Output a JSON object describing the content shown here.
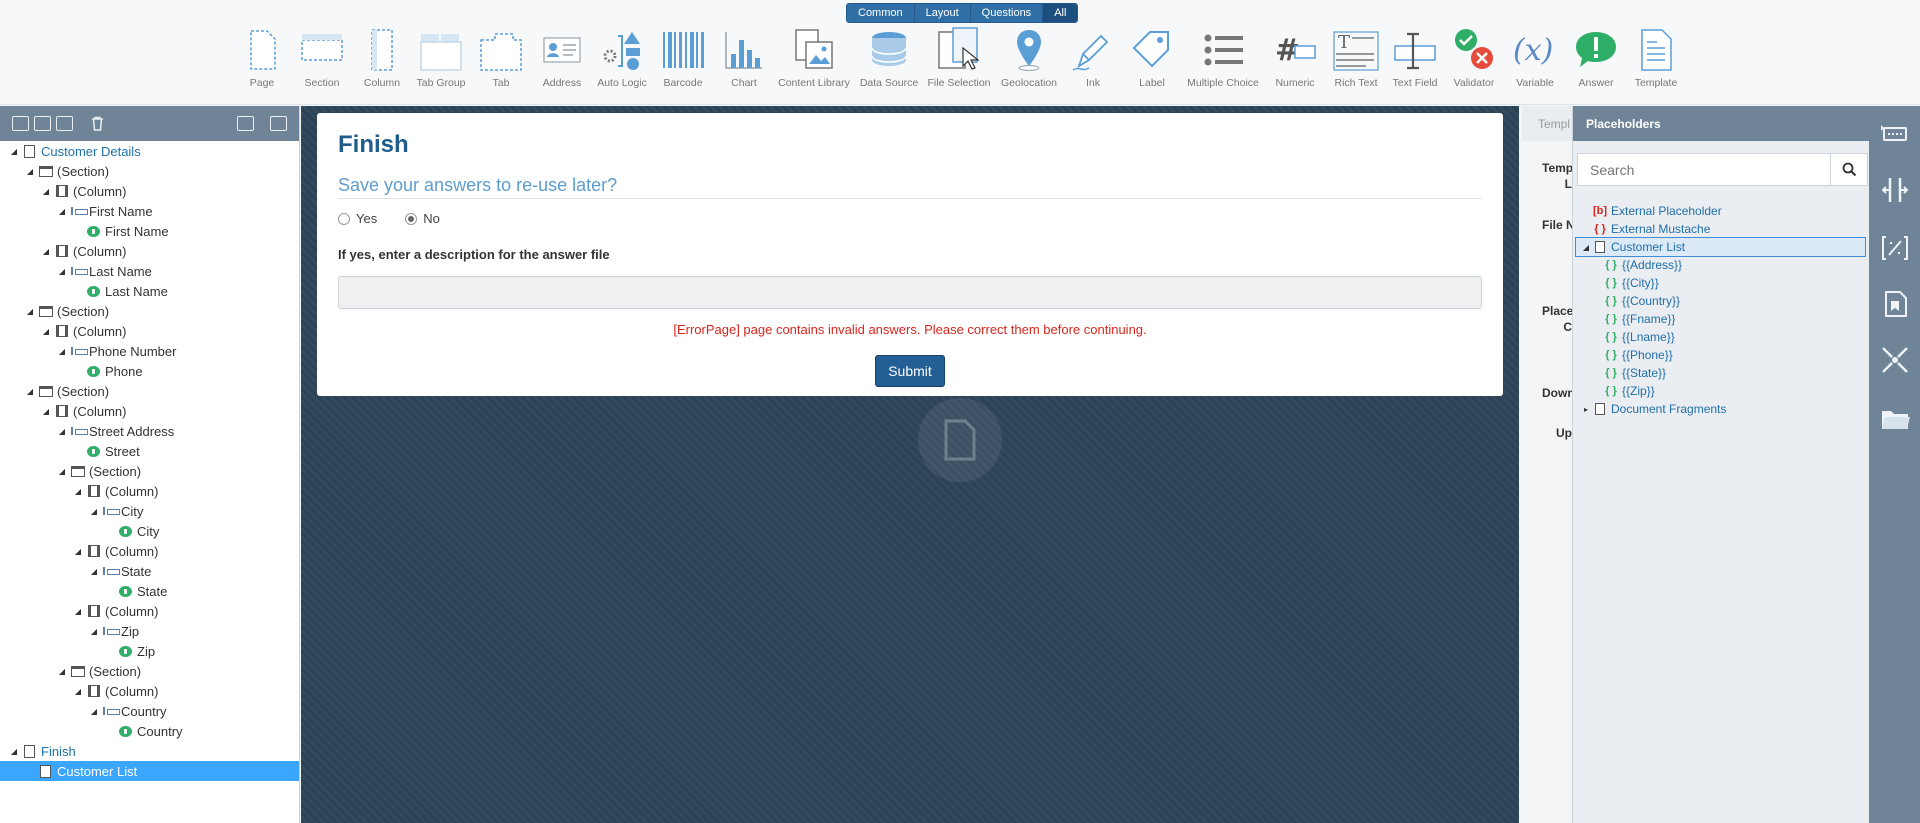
{
  "toolbar": {
    "tabs": [
      {
        "label": "Common",
        "active": false
      },
      {
        "label": "Layout",
        "active": false
      },
      {
        "label": "Questions",
        "active": false
      },
      {
        "label": "All",
        "active": true
      }
    ],
    "tools": [
      {
        "label": "Page",
        "icon": "page-icon"
      },
      {
        "label": "Section",
        "icon": "section-icon"
      },
      {
        "label": "Column",
        "icon": "column-icon"
      },
      {
        "label": "Tab Group",
        "icon": "tab-group-icon"
      },
      {
        "label": "Tab",
        "icon": "tab-icon"
      },
      {
        "label": "Address",
        "icon": "address-icon"
      },
      {
        "label": "Auto Logic",
        "icon": "auto-logic-icon"
      },
      {
        "label": "Barcode",
        "icon": "barcode-icon"
      },
      {
        "label": "Chart",
        "icon": "chart-icon"
      },
      {
        "label": "Content Library",
        "icon": "content-library-icon"
      },
      {
        "label": "Data Source",
        "icon": "data-source-icon"
      },
      {
        "label": "File Selection",
        "icon": "file-selection-icon"
      },
      {
        "label": "Geolocation",
        "icon": "geolocation-icon"
      },
      {
        "label": "Ink",
        "icon": "ink-icon"
      },
      {
        "label": "Label",
        "icon": "label-icon"
      },
      {
        "label": "Multiple Choice",
        "icon": "multiple-choice-icon"
      },
      {
        "label": "Numeric",
        "icon": "numeric-icon"
      },
      {
        "label": "Rich Text",
        "icon": "rich-text-icon"
      },
      {
        "label": "Text Field",
        "icon": "text-field-icon"
      },
      {
        "label": "Validator",
        "icon": "validator-icon"
      },
      {
        "label": "Variable",
        "icon": "variable-icon"
      },
      {
        "label": "Answer",
        "icon": "answer-icon"
      },
      {
        "label": "Template",
        "icon": "template-icon"
      }
    ]
  },
  "tree": [
    {
      "label": "Customer Details",
      "type": "page",
      "depth": 0
    },
    {
      "label": "(Section)",
      "type": "section",
      "depth": 1
    },
    {
      "label": "(Column)",
      "type": "column",
      "depth": 2
    },
    {
      "label": "First Name",
      "type": "field",
      "depth": 3
    },
    {
      "label": "First Name",
      "type": "answer",
      "depth": 4
    },
    {
      "label": "(Column)",
      "type": "column",
      "depth": 2
    },
    {
      "label": "Last Name",
      "type": "field",
      "depth": 3
    },
    {
      "label": "Last Name",
      "type": "answer",
      "depth": 4
    },
    {
      "label": "(Section)",
      "type": "section",
      "depth": 1
    },
    {
      "label": "(Column)",
      "type": "column",
      "depth": 2
    },
    {
      "label": "Phone Number",
      "type": "field",
      "depth": 3
    },
    {
      "label": "Phone",
      "type": "answer",
      "depth": 4
    },
    {
      "label": "(Section)",
      "type": "section",
      "depth": 1
    },
    {
      "label": "(Column)",
      "type": "column",
      "depth": 2
    },
    {
      "label": "Street Address",
      "type": "field",
      "depth": 3
    },
    {
      "label": "Street",
      "type": "answer",
      "depth": 4
    },
    {
      "label": "(Section)",
      "type": "section",
      "depth": 3
    },
    {
      "label": "(Column)",
      "type": "column",
      "depth": 4
    },
    {
      "label": "City",
      "type": "field",
      "depth": 5
    },
    {
      "label": "City",
      "type": "answer",
      "depth": 6
    },
    {
      "label": "(Column)",
      "type": "column",
      "depth": 4
    },
    {
      "label": "State",
      "type": "field",
      "depth": 5
    },
    {
      "label": "State",
      "type": "answer",
      "depth": 6
    },
    {
      "label": "(Column)",
      "type": "column",
      "depth": 4
    },
    {
      "label": "Zip",
      "type": "field",
      "depth": 5
    },
    {
      "label": "Zip",
      "type": "answer",
      "depth": 6
    },
    {
      "label": "(Section)",
      "type": "section",
      "depth": 3
    },
    {
      "label": "(Column)",
      "type": "column",
      "depth": 4
    },
    {
      "label": "Country",
      "type": "field",
      "depth": 5
    },
    {
      "label": "Country",
      "type": "answer",
      "depth": 6
    },
    {
      "label": "Finish",
      "type": "page",
      "depth": 0
    },
    {
      "label": "Customer List",
      "type": "doc",
      "depth": 1,
      "selected": true
    }
  ],
  "form": {
    "title": "Finish",
    "question": "Save your answers to re-use later?",
    "options": [
      {
        "label": "Yes",
        "checked": false
      },
      {
        "label": "No",
        "checked": true
      }
    ],
    "description_label": "If yes, enter a description for the answer file",
    "description_value": "",
    "error": "[ErrorPage] page contains invalid answers. Please correct them before continuing.",
    "submit_label": "Submit"
  },
  "properties": {
    "tab_label": "Templ",
    "labels": [
      "Temp",
      "L",
      "File N",
      "Placel",
      "C",
      "Down",
      "Up"
    ]
  },
  "placeholders": {
    "title": "Placeholders",
    "search_placeholder": "Search",
    "items": [
      {
        "label": "External Placeholder",
        "icon": "[b]",
        "kind": "ext",
        "depth": 0
      },
      {
        "label": "External Mustache",
        "icon": "{ }",
        "kind": "ext",
        "depth": 0
      },
      {
        "label": "Customer List",
        "icon": "doc",
        "kind": "doc",
        "depth": 0,
        "expanded": true,
        "selected": true
      },
      {
        "label": "{{Address}}",
        "icon": "{ }",
        "kind": "mustache",
        "depth": 1
      },
      {
        "label": "{{City}}",
        "icon": "{ }",
        "kind": "mustache",
        "depth": 1
      },
      {
        "label": "{{Country}}",
        "icon": "{ }",
        "kind": "mustache",
        "depth": 1
      },
      {
        "label": "{{Fname}}",
        "icon": "{ }",
        "kind": "mustache",
        "depth": 1
      },
      {
        "label": "{{Lname}}",
        "icon": "{ }",
        "kind": "mustache",
        "depth": 1
      },
      {
        "label": "{{Phone}}",
        "icon": "{ }",
        "kind": "mustache",
        "depth": 1
      },
      {
        "label": "{{State}}",
        "icon": "{ }",
        "kind": "mustache",
        "depth": 1
      },
      {
        "label": "{{Zip}}",
        "icon": "{ }",
        "kind": "mustache",
        "depth": 1
      },
      {
        "label": "Document Fragments",
        "icon": "doc",
        "kind": "doc",
        "depth": 0,
        "expanded": false
      }
    ]
  },
  "strip": [
    {
      "icon": "answer-file-icon"
    },
    {
      "icon": "split-icon"
    },
    {
      "icon": "variable-tag-icon"
    },
    {
      "icon": "bookmark-doc-icon"
    },
    {
      "icon": "collapse-icon"
    },
    {
      "icon": "folder-icon"
    }
  ]
}
